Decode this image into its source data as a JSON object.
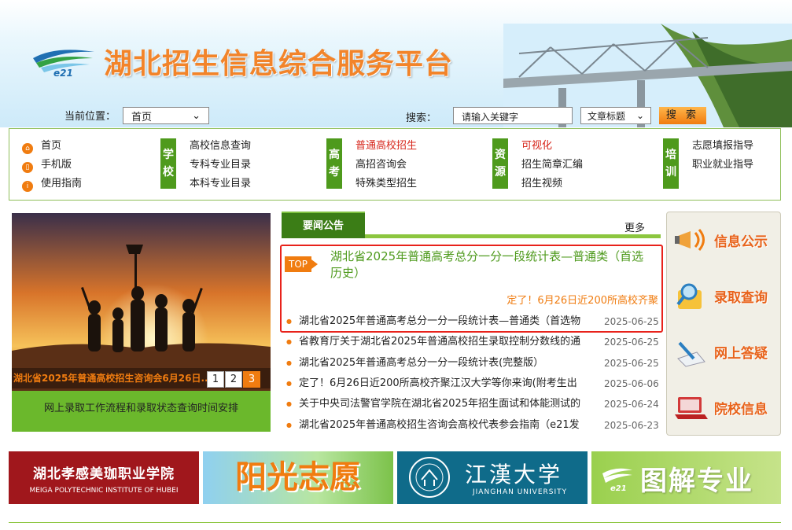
{
  "header": {
    "site_title": "湖北招生信息综合服务平台",
    "logo_text": "e21"
  },
  "toolbar": {
    "location_label": "当前位置：",
    "location_value": "首页",
    "search_label": "搜索：",
    "search_placeholder": "请输入关键字",
    "category_value": "文章标题",
    "search_button": "搜 索"
  },
  "nav": {
    "col1": [
      "首页",
      "手机版",
      "使用指南"
    ],
    "school_badge": [
      "学",
      "校"
    ],
    "school_items": [
      "高校信息查询",
      "专科专业目录",
      "本科专业目录"
    ],
    "exam_badge": [
      "高",
      "考"
    ],
    "exam_items": [
      "普通高校招生",
      "高招咨询会",
      "特殊类型招生"
    ],
    "resource_badge": [
      "资",
      "源"
    ],
    "resource_items": [
      "可视化",
      "招生简章汇编",
      "招生视频"
    ],
    "train_badge": [
      "培",
      "训"
    ],
    "train_items": [
      "志愿填报指导",
      "职业就业指导"
    ]
  },
  "slider": {
    "caption": "湖北省2025年普通高校招生咨询会6月26日...",
    "pages": [
      "1",
      "2",
      "3"
    ],
    "active_page": "3",
    "link": "网上录取工作流程和录取状态查询时间安排"
  },
  "news": {
    "tab": "要闻公告",
    "more": "更多",
    "top_tag": "TOP",
    "top_title": "湖北省2025年普通高考总分一分一段统计表—普通类（首选历史）",
    "top_sub": "定了！6月26日近200所高校齐聚",
    "items": [
      {
        "title": "湖北省2025年普通高考总分一分一段统计表—普通类（首选物",
        "date": "2025-06-25"
      },
      {
        "title": "省教育厅关于湖北省2025年普通高校招生录取控制分数线的通",
        "date": "2025-06-25"
      },
      {
        "title": "湖北省2025年普通高考总分一分一段统计表(完整版）",
        "date": "2025-06-25"
      },
      {
        "title": "定了！6月26日近200所高校齐聚江汉大学等你来询(附考生出",
        "date": "2025-06-06"
      },
      {
        "title": "关于中央司法警官学院在湖北省2025年招生面试和体能测试的",
        "date": "2025-06-24"
      },
      {
        "title": "湖北省2025年普通高校招生咨询会高校代表参会指南（e21发",
        "date": "2025-06-23"
      }
    ]
  },
  "side": [
    "信息公示",
    "录取查询",
    "网上答疑",
    "院校信息"
  ],
  "ads": {
    "ad1_cn": "湖北孝感美珈职业学院",
    "ad1_en": "MEIGA POLYTECHNIC INSTITUTE OF HUBEI",
    "ad2": "阳光志愿",
    "ad3_cn": "江漢大学",
    "ad3_en": "JIANGHAN UNIVERSITY",
    "ad4": "图解专业",
    "ad4_logo": "e21"
  },
  "colors": {
    "accent": "#f07c10",
    "green": "#4e9a1c",
    "red": "#e8221b"
  }
}
